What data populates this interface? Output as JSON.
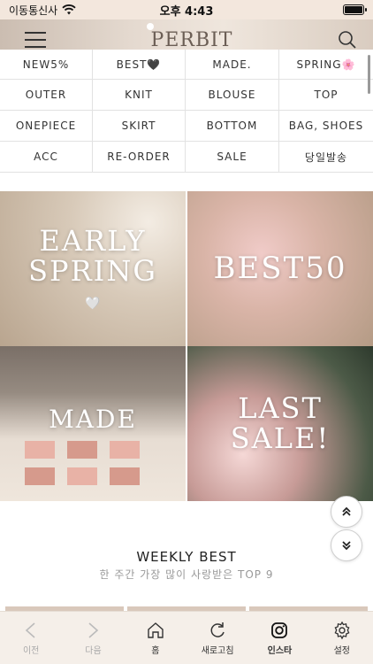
{
  "status_bar": {
    "carrier": "이동통신사",
    "time": "오후 4:43"
  },
  "header": {
    "logo": "PERBIT"
  },
  "categories": [
    "NEW5%",
    "BEST🖤",
    "MADE.",
    "SPRING🌸",
    "OUTER",
    "KNIT",
    "BLOUSE",
    "TOP",
    "ONEPIECE",
    "SKIRT",
    "BOTTOM",
    "BAG, SHOES",
    "ACC",
    "RE-ORDER",
    "SALE",
    "당일발송"
  ],
  "banners": [
    {
      "line1": "EARLY",
      "line2": "SPRING",
      "heart": "🤍"
    },
    {
      "line1": "BEST50",
      "line2": ""
    },
    {
      "line1": "MADE",
      "line2": ""
    },
    {
      "line1": "LAST",
      "line2": "SALE!"
    }
  ],
  "weekly": {
    "title": "WEEKLY BEST",
    "subtitle": "한 주간 가장 많이 사랑받은 TOP 9"
  },
  "bottom_nav": [
    {
      "label": "이전",
      "icon": "back-arrow-icon",
      "enabled": false
    },
    {
      "label": "다음",
      "icon": "forward-arrow-icon",
      "enabled": false
    },
    {
      "label": "홈",
      "icon": "home-icon",
      "enabled": true
    },
    {
      "label": "새로고침",
      "icon": "refresh-icon",
      "enabled": true
    },
    {
      "label": "인스타",
      "icon": "instagram-icon",
      "enabled": true,
      "active": true
    },
    {
      "label": "설정",
      "icon": "gear-icon",
      "enabled": true
    }
  ]
}
